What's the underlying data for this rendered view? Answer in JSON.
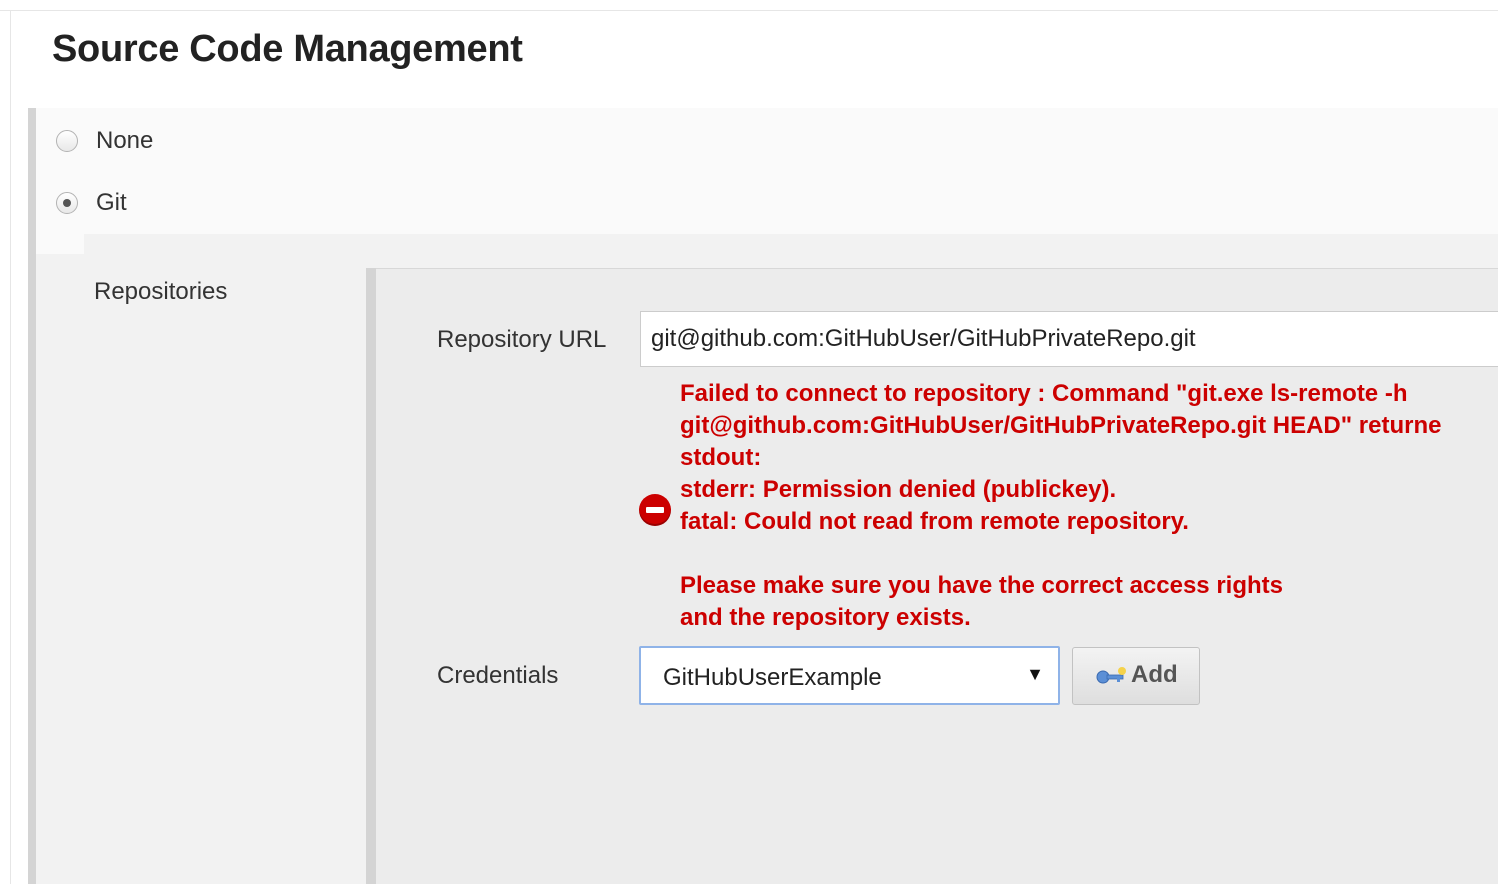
{
  "section": {
    "title": "Source Code Management"
  },
  "scm_options": [
    {
      "label": "None",
      "selected": false
    },
    {
      "label": "Git",
      "selected": true
    }
  ],
  "git": {
    "repositories_label": "Repositories",
    "repository_url": {
      "label": "Repository URL",
      "value": "git@github.com:GitHubUser/GitHubPrivateRepo.git"
    },
    "error": {
      "lines": [
        "Failed to connect to repository : Command \"git.exe ls-remote -h",
        "git@github.com:GitHubUser/GitHubPrivateRepo.git HEAD\" returne",
        "stdout:",
        "stderr: Permission denied (publickey).",
        "fatal: Could not read from remote repository.",
        "",
        "Please make sure you have the correct access rights",
        "and the repository exists."
      ],
      "color": "#cc0000"
    },
    "credentials": {
      "label": "Credentials",
      "selected": "GitHubUserExample",
      "add_label": "Add"
    }
  },
  "icons": {
    "radio": "radio-button",
    "error": "error-icon",
    "key": "key-icon",
    "caret": "dropdown-caret-icon"
  },
  "colors": {
    "error": "#cc0000",
    "focus_border": "#8fb3e8"
  }
}
